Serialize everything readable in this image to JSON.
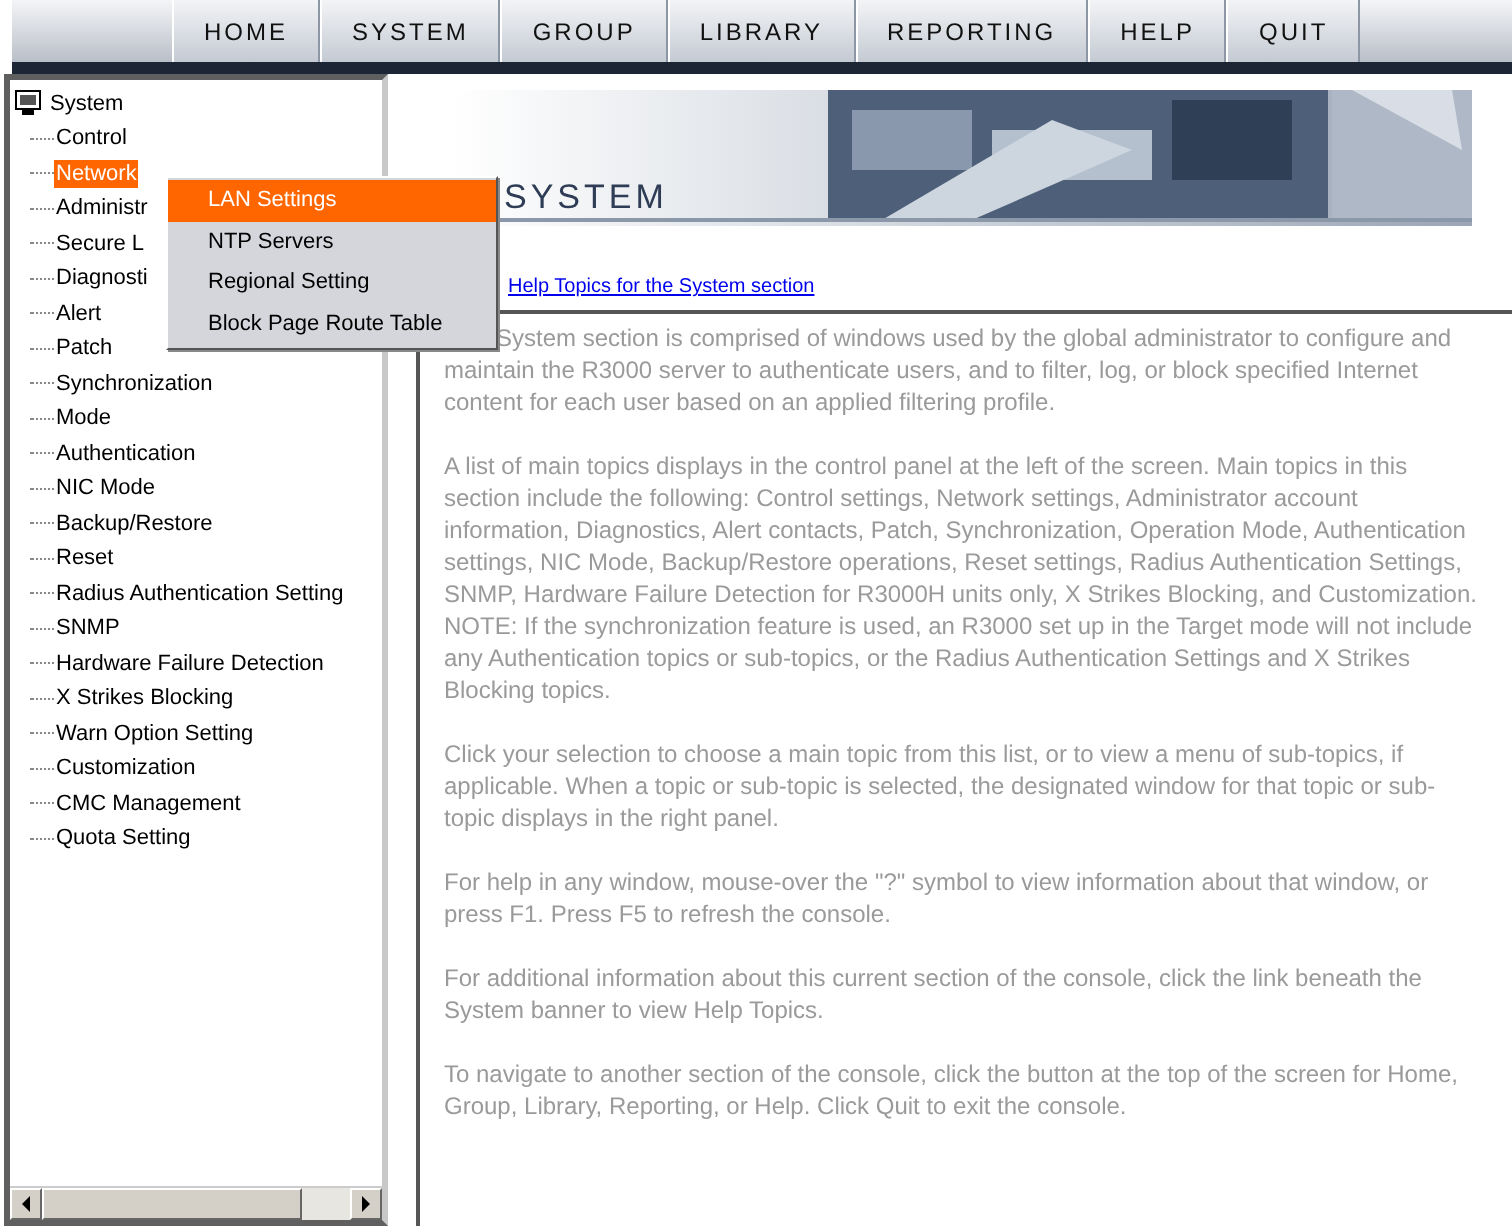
{
  "nav": [
    {
      "label": "HOME"
    },
    {
      "label": "SYSTEM"
    },
    {
      "label": "GROUP"
    },
    {
      "label": "LIBRARY"
    },
    {
      "label": "REPORTING"
    },
    {
      "label": "HELP"
    },
    {
      "label": "QUIT"
    }
  ],
  "tree": {
    "label": "System",
    "children": [
      {
        "label": "Control",
        "selected": false
      },
      {
        "label": "Network",
        "selected": true
      },
      {
        "label": "Administr",
        "selected": false
      },
      {
        "label": "Secure L",
        "selected": false
      },
      {
        "label": "Diagnosti",
        "selected": false
      },
      {
        "label": "Alert",
        "selected": false
      },
      {
        "label": "Patch",
        "selected": false
      },
      {
        "label": "Synchronization",
        "selected": false
      },
      {
        "label": "Mode",
        "selected": false
      },
      {
        "label": "Authentication",
        "selected": false
      },
      {
        "label": "NIC Mode",
        "selected": false
      },
      {
        "label": "Backup/Restore",
        "selected": false
      },
      {
        "label": "Reset",
        "selected": false
      },
      {
        "label": "Radius Authentication Setting",
        "selected": false
      },
      {
        "label": "SNMP",
        "selected": false
      },
      {
        "label": "Hardware Failure Detection",
        "selected": false
      },
      {
        "label": "X Strikes Blocking",
        "selected": false
      },
      {
        "label": "Warn Option Setting",
        "selected": false
      },
      {
        "label": "Customization",
        "selected": false
      },
      {
        "label": "CMC Management",
        "selected": false
      },
      {
        "label": "Quota Setting",
        "selected": false
      }
    ]
  },
  "popup_menu": [
    {
      "label": "LAN Settings",
      "selected": true
    },
    {
      "label": "NTP Servers",
      "selected": false
    },
    {
      "label": "Regional Setting",
      "selected": false
    },
    {
      "label": "Block Page Route Table",
      "selected": false
    }
  ],
  "banner": {
    "title": "SYSTEM"
  },
  "help_link": "Help Topics for the System section",
  "paragraphs": [
    "System section is comprised of windows used by the global administrator to configure and maintain the R3000 server to authenticate users, and to filter, log, or block specified Internet content for each user based on an applied filtering profile.",
    "A list of main topics displays in the control panel at the left of the screen. Main topics in this section include the following: Control settings, Network settings, Administrator account information, Diagnostics, Alert contacts, Patch, Synchronization, Operation Mode, Authentication settings, NIC Mode, Backup/Restore operations, Reset settings, Radius Authentication Settings, SNMP, Hardware Failure Detection for R3000H units only, X Strikes Blocking, and Customization. NOTE: If the synchronization feature is used, an R3000 set up in the Target mode will not include any Authentication topics or sub-topics, or the Radius Authentication Settings and X Strikes Blocking topics.",
    "Click your selection to choose a main topic from this list, or to view a menu of sub-topics, if applicable. When a topic or sub-topic is selected, the designated window for that topic or sub-topic displays in the right panel.",
    "For help in any window, mouse-over the \"?\" symbol to view information about that window, or press F1. Press F5 to refresh the console.",
    "For additional information about this current section of the console, click the link beneath the System banner to view Help Topics.",
    "To navigate to another section of the console, click the button at the top of the screen for Home, Group, Library, Reporting, or Help. Click Quit to exit the console."
  ]
}
